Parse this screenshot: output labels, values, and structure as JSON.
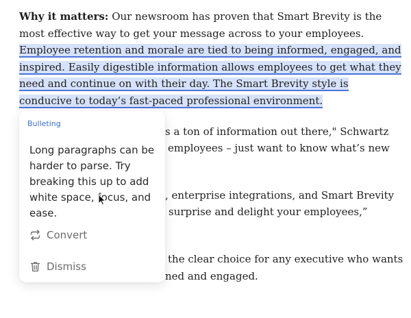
{
  "document": {
    "para1": {
      "lead": "Why it matters:",
      "plain": " Our newsroom has proven that Smart Brevity is the most effective way to get your message across to your employees. ",
      "highlighted": "Employee retention and morale are tied to being informed, engaged, and inspired. Easily digestible information allows employees to get what they need and continue on with their day. The Smart Brevity style is conducive to today’s fast-paced professional environment."
    },
    "partial_lines": [
      "s a ton of information out there,\" Schwartz",
      "employees – just want to know what’s new",
      ", enterprise integrations, and Smart Brevity",
      "surprise and delight your employees,”",
      "the clear choice for any executive who wants",
      "ned and engaged."
    ]
  },
  "suggestion": {
    "category": "Bulleting",
    "message": "Long paragraphs can be harder to parse. Try breaking this up to add white space, focus, and ease.",
    "actions": {
      "convert": "Convert",
      "dismiss": "Dismiss"
    }
  },
  "colors": {
    "highlight_bg": "#d6e2fb",
    "highlight_underline": "#4a74d9",
    "label_accent": "#3d6fd6"
  },
  "icons": {
    "convert": "convert-arrows-icon",
    "dismiss": "trash-icon",
    "cursor": "mouse-cursor-icon"
  }
}
